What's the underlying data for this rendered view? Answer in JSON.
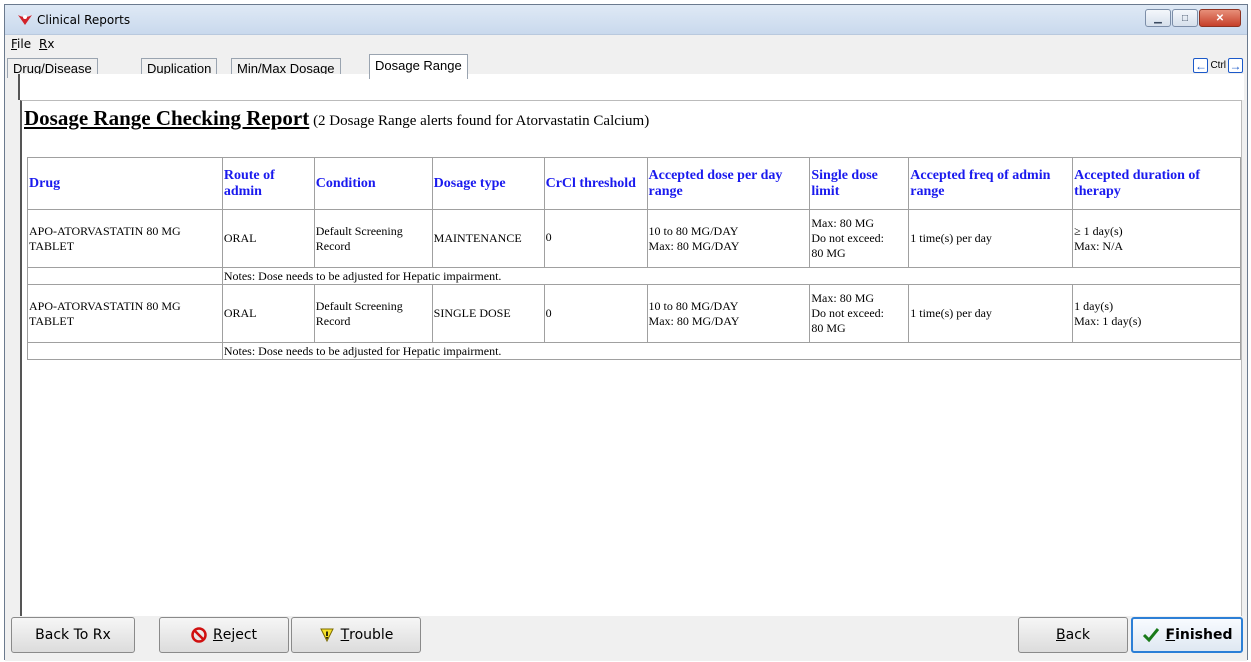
{
  "window": {
    "title": "Clinical Reports"
  },
  "menu": [
    {
      "label": "File",
      "accel": "F",
      "rest": "ile"
    },
    {
      "label": "Rx",
      "accel": "R",
      "rest": "x"
    }
  ],
  "tabs": [
    {
      "label": "Drug/Disease"
    },
    {
      "label": "Duplication"
    },
    {
      "label": "Min/Max Dosage"
    },
    {
      "label": "Dosage Range"
    }
  ],
  "nav": {
    "ctrl_label": "Ctrl"
  },
  "report": {
    "title": "Dosage Range Checking Report",
    "subtitle": "(2 Dosage Range alerts found for Atorvastatin Calcium)",
    "columns": [
      "Drug",
      "Route of admin",
      "Condition",
      "Dosage type",
      "CrCl threshold",
      "Accepted dose per day range",
      "Single dose limit",
      "Accepted freq of admin range",
      "Accepted duration of therapy"
    ],
    "rows": [
      {
        "drug": "APO-ATORVASTATIN 80 MG TABLET",
        "route": "ORAL",
        "condition": "Default Screening Record",
        "dosage_type": "MAINTENANCE",
        "crcl": "0",
        "dose_range_1": "10 to 80 MG/DAY",
        "dose_range_2": "Max: 80 MG/DAY",
        "single_1": "Max: 80 MG",
        "single_2": "Do not exceed:",
        "single_3": "80 MG",
        "freq": "1 time(s) per day",
        "duration_1": "≥ 1 day(s)",
        "duration_2": "Max: N/A",
        "notes": "Notes: Dose needs to be adjusted for Hepatic impairment."
      },
      {
        "drug": "APO-ATORVASTATIN 80 MG TABLET",
        "route": "ORAL",
        "condition": "Default Screening Record",
        "dosage_type": "SINGLE DOSE",
        "crcl": "0",
        "dose_range_1": "10 to 80 MG/DAY",
        "dose_range_2": "Max: 80 MG/DAY",
        "single_1": "Max: 80 MG",
        "single_2": "Do not exceed:",
        "single_3": "80 MG",
        "freq": "1 time(s) per day",
        "duration_1": "1 day(s)",
        "duration_2": "Max: 1 day(s)",
        "notes": "Notes: Dose needs to be adjusted for Hepatic impairment."
      }
    ]
  },
  "buttons": {
    "back_to_rx": "Back To Rx",
    "reject_accel": "R",
    "reject_rest": "eject",
    "trouble_accel": "T",
    "trouble_rest": "rouble",
    "back_accel": "B",
    "back_rest": "ack",
    "finished_accel": "F",
    "finished_rest": "inished"
  },
  "colors": {
    "header_text": "#1a1aee",
    "primary_border": "#2c7fd6"
  }
}
